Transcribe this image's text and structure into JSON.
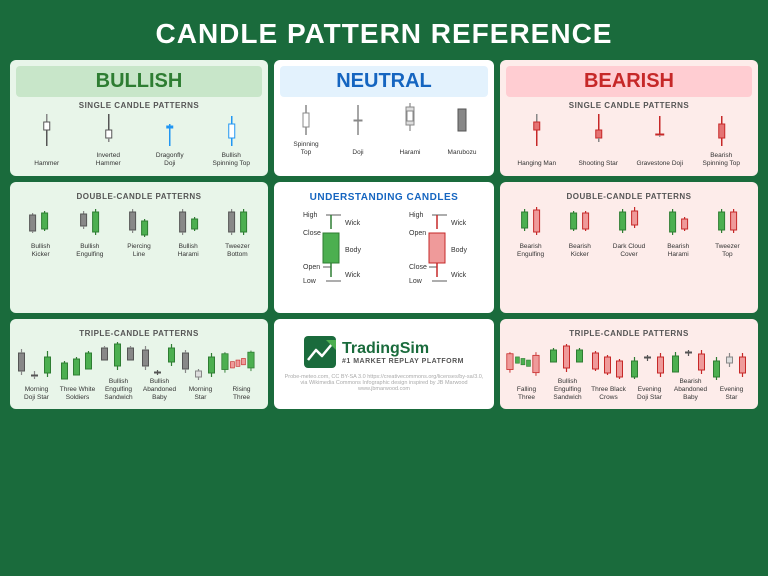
{
  "title": "CANDLE PATTERN REFERENCE",
  "columns": {
    "bullish": {
      "header": "BULLISH",
      "single_label": "SINGLE CANDLE PATTERNS",
      "double_label": "DOUBLE-CANDLE PATTERNS",
      "triple_label": "TRIPLE-CANDLE PATTERNS",
      "single_patterns": [
        "Hammer",
        "Inverted\nHammer",
        "Dragonfly\nDoji",
        "Bullish\nSpinning Top"
      ],
      "double_patterns": [
        "Bullish\nKicker",
        "Bullish\nEngulfing",
        "Piercing\nLine",
        "Bullish\nHarami",
        "Tweezer\nBottom"
      ],
      "triple_patterns": [
        "Morning\nDoji Star",
        "Three White\nSoldiers",
        "Bullish\nEngulfing\nSandwich",
        "Bullish\nAbandoned\nBaby",
        "Morning\nStar",
        "Rising\nThree"
      ]
    },
    "neutral": {
      "header": "NEUTRAL",
      "single_patterns": [
        "Spinning\nTop",
        "Doji",
        "Harami",
        "Marubozu"
      ]
    },
    "bearish": {
      "header": "BEARISH",
      "single_label": "SINGLE CANDLE PATTERNS",
      "double_label": "DOUBLE-CANDLE PATTERNS",
      "triple_label": "TRIPLE-CANDLE PATTERNS",
      "single_patterns": [
        "Hanging Man",
        "Shooting Star",
        "Gravestone Doji",
        "Bearish\nSpinning Top"
      ],
      "double_patterns": [
        "Bearish\nEngulfing",
        "Bearish\nKicker",
        "Dark Cloud\nCover",
        "Bearish\nHarami",
        "Tweezer\nTop"
      ],
      "triple_patterns": [
        "Falling\nThree",
        "Bullish\nEngulfing\nSandwich",
        "Three Black\nCrows",
        "Evening\nDoji Star",
        "Bearish\nAbandoned\nBaby",
        "Evening\nStar"
      ]
    }
  },
  "understanding": {
    "label": "UNDERSTANDING CANDLES",
    "green_parts": [
      "High",
      "Close",
      "Open",
      "Low"
    ],
    "red_parts": [
      "High",
      "Open",
      "Close",
      "Low"
    ]
  },
  "footer": {
    "brand": "TradingSim",
    "tagline": "#1 MARKET REPLAY PLATFORM",
    "credits": "Probe-meteo.com, CC BY-SA 3.0 https://creativecommons.org/licenses/by-sa/3.0, via Wikimedia Commons    Infographic design inspired by JB Marwood www.jbmarwood.com"
  }
}
